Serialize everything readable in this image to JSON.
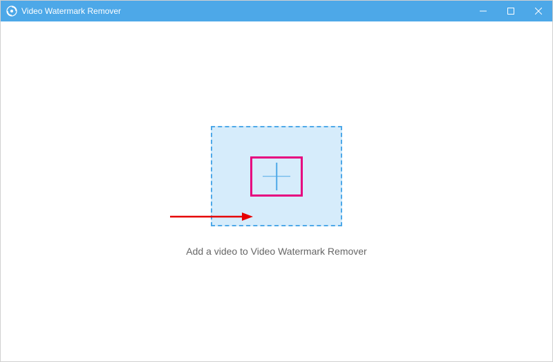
{
  "titlebar": {
    "app_title": "Video Watermark Remover"
  },
  "main": {
    "instruction_text": "Add a video to Video Watermark Remover"
  },
  "icons": {
    "app_icon": "app-logo-icon",
    "minimize": "minimize-icon",
    "maximize": "maximize-icon",
    "close": "close-icon",
    "add": "plus-icon"
  },
  "annotation": {
    "arrow": "arrow-right-annotation"
  }
}
